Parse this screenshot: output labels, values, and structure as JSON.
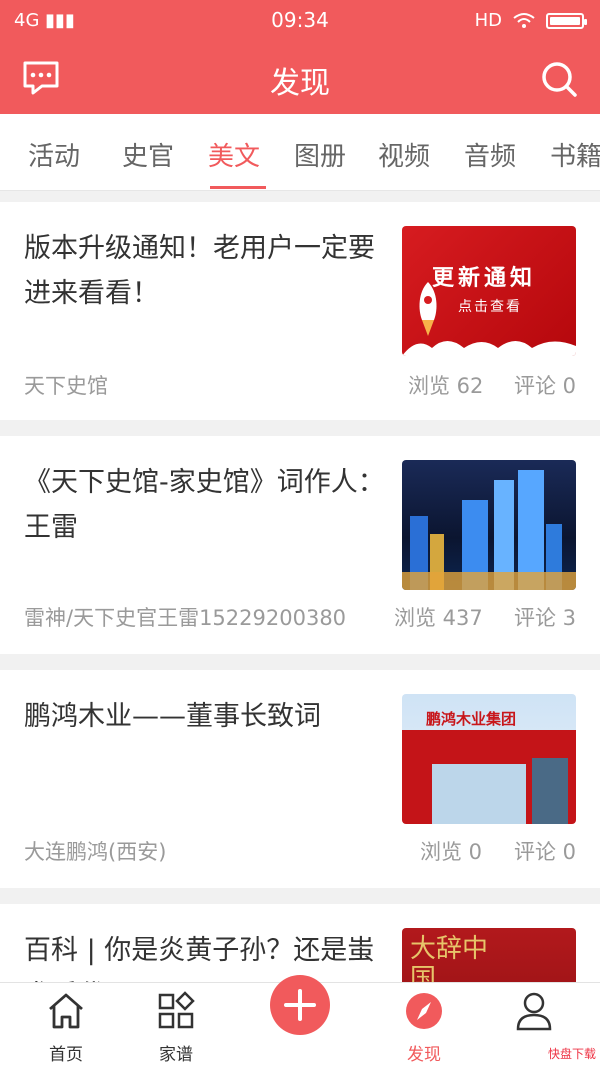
{
  "status": {
    "network": "4G",
    "time": "09:34",
    "hd": "HD"
  },
  "header": {
    "title": "发现"
  },
  "tabs": [
    "活动",
    "史官",
    "美文",
    "图册",
    "视频",
    "音频",
    "书籍"
  ],
  "active_tab": "美文",
  "articles": [
    {
      "title": "版本升级通知！老用户一定要进来看看！",
      "author": "天下史馆",
      "views": "浏览 62",
      "comments": "评论 0",
      "thumb_title": "更新通知",
      "thumb_sub": "点击查看"
    },
    {
      "title": "《天下史馆-家史馆》词作人：王雷",
      "author": "雷神/天下史官王雷15229200380",
      "views": "浏览 437",
      "comments": "评论 3"
    },
    {
      "title": "鹏鸿木业——董事长致词",
      "author": "大连鹏鸿(西安)",
      "views": "浏览 0",
      "comments": "评论 0",
      "thumb_sign": "鹏鸿木业集团"
    },
    {
      "title": "百科 | 你是炎黄子孙？还是蚩尤后代？",
      "thumb_text": "大辞中国"
    }
  ],
  "nav": [
    {
      "label": "首页",
      "icon": "home-icon"
    },
    {
      "label": "家谱",
      "icon": "grid-icon"
    },
    {
      "label": "",
      "icon": "plus-icon"
    },
    {
      "label": "发现",
      "icon": "compass-icon"
    },
    {
      "label": "",
      "icon": "user-icon"
    }
  ],
  "watermark": "快盘下载",
  "colors": {
    "accent": "#f15a5c"
  }
}
